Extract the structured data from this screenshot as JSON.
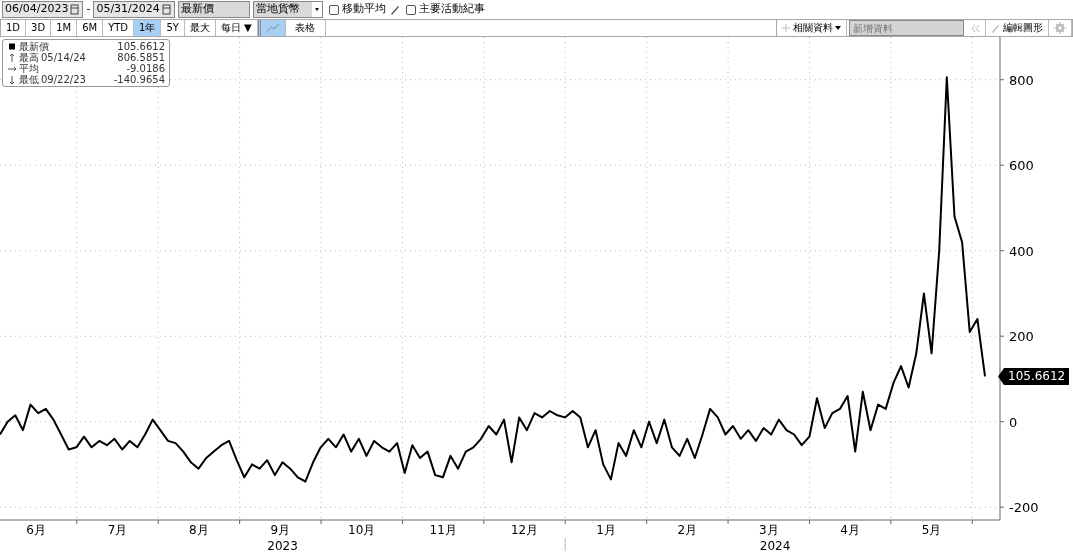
{
  "toolbar": {
    "start_date": "06/04/2023",
    "separator": "-",
    "end_date": "05/31/2024",
    "price_field": "最新價",
    "currency": "當地貨幣",
    "checkboxes": [
      {
        "label": "移動平均",
        "checked": false,
        "kind": "pencil"
      },
      {
        "label": "主要活動紀事",
        "checked": false,
        "kind": "plain"
      }
    ]
  },
  "periods": [
    {
      "label": "1D",
      "selected": false
    },
    {
      "label": "3D",
      "selected": false
    },
    {
      "label": "1M",
      "selected": false
    },
    {
      "label": "6M",
      "selected": false
    },
    {
      "label": "YTD",
      "selected": false
    },
    {
      "label": "1年",
      "selected": true
    },
    {
      "label": "5Y",
      "selected": false
    },
    {
      "label": "最大",
      "selected": false
    }
  ],
  "frequency": "每日 ▼",
  "views": [
    {
      "kind": "chart",
      "selected": true
    },
    {
      "kind": "table",
      "label": "表格",
      "selected": false
    }
  ],
  "right_tools": {
    "related": "相關資料",
    "add_placeholder": "新增資料",
    "edit": "編輯圖形"
  },
  "legend": [
    {
      "kind": "last",
      "label": "最新價",
      "value": "105.6612"
    },
    {
      "kind": "high",
      "label": "最高",
      "date": "05/14/24",
      "value": "806.5851"
    },
    {
      "kind": "average",
      "label": "平均",
      "value": "-9.0186"
    },
    {
      "kind": "low",
      "label": "最低",
      "date": "09/22/23",
      "value": "-140.9654"
    }
  ],
  "price_tag": "105.6612",
  "time_axis": [
    {
      "year": "2023",
      "months": [
        "6月",
        "7月",
        "8月",
        "9月",
        "10月",
        "11月",
        "12月"
      ]
    },
    {
      "year": "2024",
      "months": [
        "1月",
        "2月",
        "3月",
        "4月",
        "5月"
      ]
    }
  ],
  "chart_data": {
    "type": "line",
    "grid": true,
    "ylim": [
      -230,
      900
    ],
    "yticks": [
      -200,
      0,
      200,
      400,
      600,
      800
    ],
    "series": [
      {
        "color": "#000000",
        "values": [
          -30,
          0,
          15,
          -20,
          40,
          20,
          30,
          5,
          -30,
          -65,
          -60,
          -35,
          -60,
          -45,
          -55,
          -40,
          -65,
          -45,
          -60,
          -30,
          5,
          -20,
          -45,
          -50,
          -70,
          -95,
          -110,
          -85,
          -70,
          -55,
          -45,
          -90,
          -130,
          -100,
          -110,
          -90,
          -125,
          -95,
          -110,
          -130,
          -140,
          -95,
          -60,
          -40,
          -60,
          -30,
          -70,
          -40,
          -80,
          -45,
          -60,
          -70,
          -50,
          -120,
          -55,
          -85,
          -70,
          -125,
          -130,
          -80,
          -110,
          -70,
          -60,
          -40,
          -10,
          -30,
          5,
          -95,
          10,
          -20,
          20,
          10,
          25,
          15,
          10,
          25,
          10,
          -60,
          -20,
          -100,
          -135,
          -50,
          -80,
          -20,
          -60,
          0,
          -50,
          5,
          -60,
          -80,
          -40,
          -85,
          -30,
          30,
          10,
          -30,
          -10,
          -40,
          -20,
          -45,
          -15,
          -30,
          5,
          -20,
          -30,
          -55,
          -35,
          55,
          -15,
          20,
          30,
          60,
          -70,
          70,
          -20,
          40,
          30,
          90,
          130,
          80,
          160,
          300,
          160,
          400,
          806,
          480,
          420,
          210,
          240,
          106
        ]
      }
    ]
  }
}
